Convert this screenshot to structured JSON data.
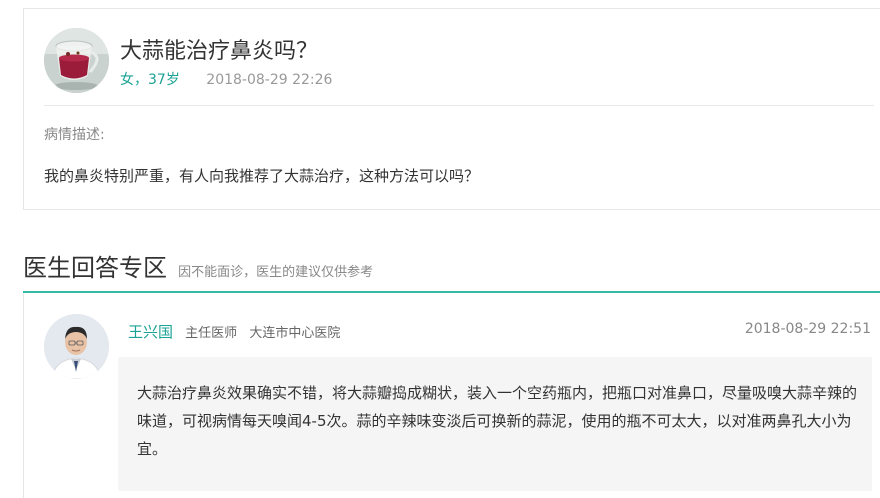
{
  "question": {
    "title": "大蒜能治疗鼻炎吗？",
    "patient": "女，37岁",
    "time": "2018-08-29 22:26",
    "description_label": "病情描述:",
    "description": "我的鼻炎特别严重，有人向我推荐了大蒜治疗，这种方法可以吗？"
  },
  "answers_section": {
    "title": "医生回答专区",
    "note": "因不能面诊，医生的建议仅供参考"
  },
  "answer": {
    "doctor_name": "王兴国",
    "doctor_title": "主任医师",
    "hospital": "大连市中心医院",
    "time": "2018-08-29 22:51",
    "text": "大蒜治疗鼻炎效果确实不错，将大蒜瓣捣成糊状，装入一个空药瓶内，把瓶口对准鼻口，尽量吸嗅大蒜辛辣的味道，可视病情每天嗅闻4-5次。蒜的辛辣味变淡后可换新的蒜泥，使用的瓶不可太大，以对准两鼻孔大小为宜。"
  },
  "colors": {
    "accent": "#1aa394",
    "section_bar": "#35b8a6"
  }
}
